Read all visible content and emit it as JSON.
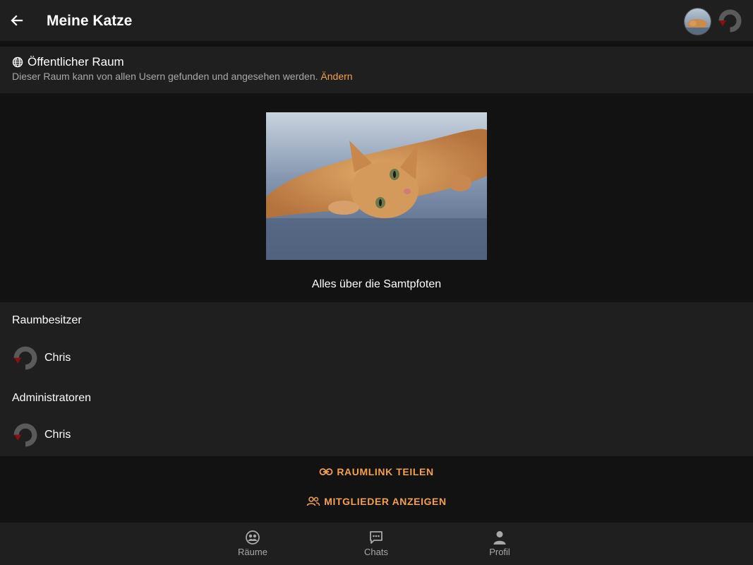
{
  "header": {
    "title": "Meine Katze"
  },
  "public_room": {
    "title": "Öffentlicher Raum",
    "description": "Dieser Raum kann von allen Usern gefunden und angesehen werden.",
    "change_link": "Ändern"
  },
  "room": {
    "topic": "Alles über die Samtpfoten"
  },
  "owners": {
    "label": "Raumbesitzer",
    "members": [
      {
        "name": "Chris"
      }
    ]
  },
  "admins": {
    "label": "Administratoren",
    "members": [
      {
        "name": "Chris"
      }
    ]
  },
  "actions": {
    "share_link": "RAUMLINK TEILEN",
    "show_members": "MITGLIEDER ANZEIGEN"
  },
  "bottom_nav": {
    "items": [
      {
        "label": "Räume",
        "icon": "rooms-icon"
      },
      {
        "label": "Chats",
        "icon": "chats-icon"
      },
      {
        "label": "Profil",
        "icon": "profile-icon"
      }
    ]
  },
  "colors": {
    "accent": "#f2a04a",
    "surface": "#1f1f1f",
    "background": "#121212",
    "muted_text": "#a8a8a8"
  }
}
